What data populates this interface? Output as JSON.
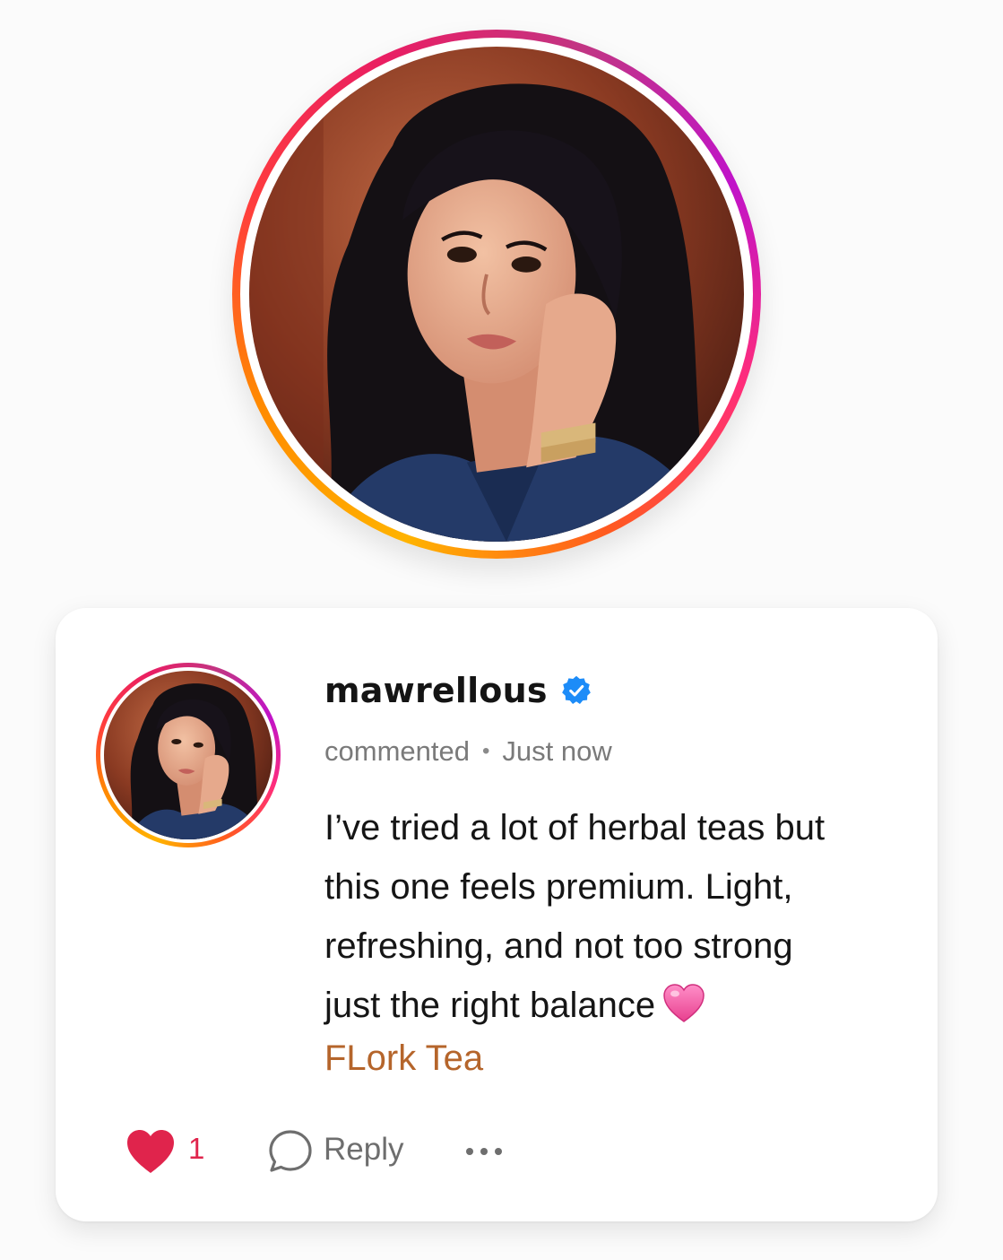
{
  "comment": {
    "username": "mawrellous",
    "verified": true,
    "action": "commented",
    "separator": "•",
    "timestamp": "Just now",
    "body_lines": [
      "I’ve tried a lot of herbal teas but",
      "this one feels premium. Light,",
      "refreshing, and not too strong",
      "just the right balance"
    ],
    "emoji": "pink-heart-emoji",
    "brand": "FLork Tea",
    "likes": "1",
    "reply_label": "Reply",
    "more_icon": "ellipsis-icon"
  },
  "colors": {
    "brand_text": "#b5652b",
    "like_red": "#e0244c",
    "verified_blue": "#1d8cf8",
    "story_ring": [
      "#ffb300",
      "#ff3d3d",
      "#c013c9"
    ]
  }
}
